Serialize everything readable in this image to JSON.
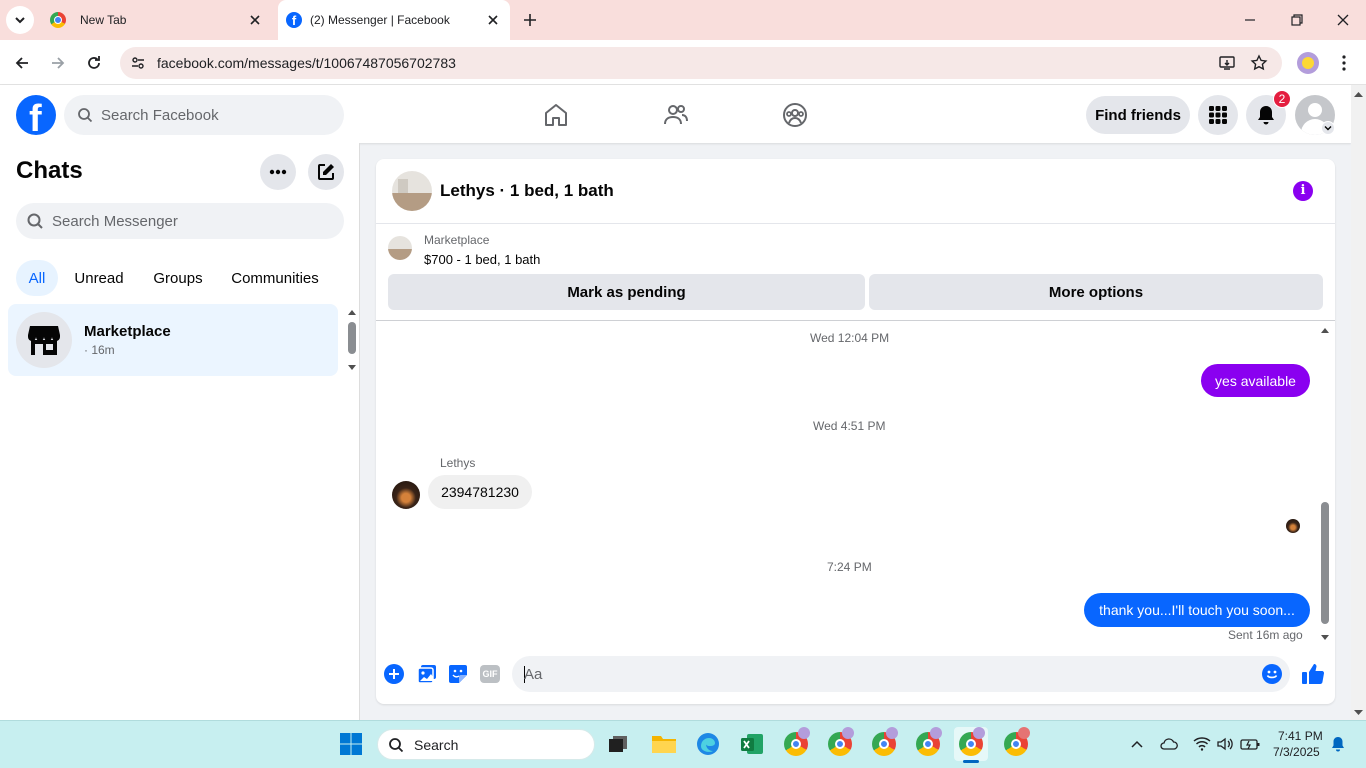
{
  "browser": {
    "tabs": [
      {
        "label": "New Tab"
      },
      {
        "label": "(2) Messenger | Facebook"
      }
    ],
    "url": "facebook.com/messages/t/10067487056702783"
  },
  "fb_header": {
    "search_placeholder": "Search Facebook",
    "find_friends_label": "Find friends",
    "notification_count": "2"
  },
  "chats_panel": {
    "title": "Chats",
    "search_placeholder": "Search Messenger",
    "filters": [
      "All",
      "Unread",
      "Groups",
      "Communities"
    ],
    "active_filter": "All",
    "conversations": [
      {
        "name": "Marketplace",
        "meta": "· 16m"
      }
    ]
  },
  "conversation": {
    "header_title": "Lethys · 1 bed, 1 bath",
    "listing": {
      "source": "Marketplace",
      "summary": "$700 - 1 bed, 1 bath"
    },
    "actions": {
      "mark_pending": "Mark as pending",
      "more_options": "More options"
    },
    "messages": {
      "ts1": "Wed 12:04 PM",
      "msg1": "yes available",
      "ts2": "Wed 4:51 PM",
      "sender_name": "Lethys",
      "msg2": "2394781230",
      "ts3": "7:24 PM",
      "msg3": "thank you...I'll touch you soon...",
      "receipt": "Sent 16m ago"
    },
    "composer": {
      "placeholder": "Aa",
      "gif_label": "GIF"
    },
    "accent_color": "#0866ff",
    "theme_purple": "#8a00f0"
  },
  "taskbar": {
    "search_label": "Search",
    "time": "7:41 PM",
    "date": "7/3/2025"
  }
}
